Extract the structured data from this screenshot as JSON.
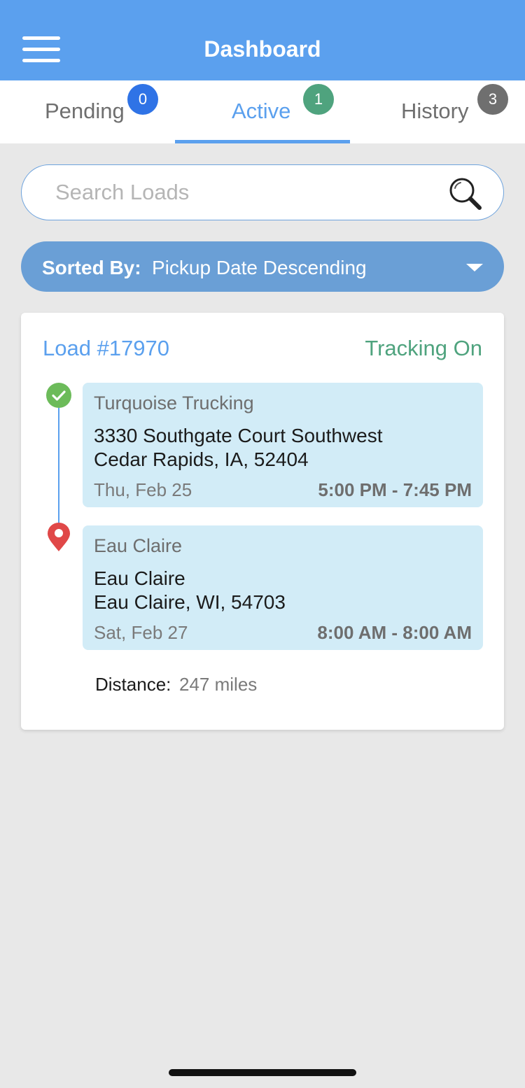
{
  "header": {
    "title": "Dashboard",
    "menu_icon": "hamburger-menu-icon"
  },
  "tabs": [
    {
      "label": "Pending",
      "count": "0",
      "badge_color": "#2f73e6",
      "active": false
    },
    {
      "label": "Active",
      "count": "1",
      "badge_color": "#4fa37e",
      "active": true
    },
    {
      "label": "History",
      "count": "3",
      "badge_color": "#6f6f6f",
      "active": false
    }
  ],
  "search": {
    "placeholder": "Search Loads",
    "value": "",
    "icon": "search-icon"
  },
  "sort": {
    "key_label": "Sorted By:",
    "value": "Pickup Date Descending"
  },
  "load": {
    "number_label": "Load #17970",
    "tracking_status": "Tracking On",
    "stops": [
      {
        "type": "pickup",
        "status_icon": "check-circle-icon",
        "name": "Turquoise Trucking",
        "address_line1": "3330 Southgate Court Southwest",
        "address_line2": "Cedar Rapids, IA, 52404",
        "date": "Thu, Feb 25",
        "time_window": "5:00 PM - 7:45 PM"
      },
      {
        "type": "delivery",
        "status_icon": "map-pin-icon",
        "name": "Eau Claire",
        "address_line1": "Eau Claire",
        "address_line2": "Eau Claire, WI, 54703",
        "date": "Sat, Feb 27",
        "time_window": "8:00 AM - 8:00 AM"
      }
    ],
    "distance_label": "Distance:",
    "distance_value": "247 miles"
  },
  "colors": {
    "accent": "#5ba0ee",
    "sort_bar": "#6a9fd6",
    "tracking": "#4fa37e",
    "stop_bg": "#d2ecf7",
    "check": "#6cbb5a",
    "pin": "#e04848",
    "background": "#e8e8e8"
  }
}
